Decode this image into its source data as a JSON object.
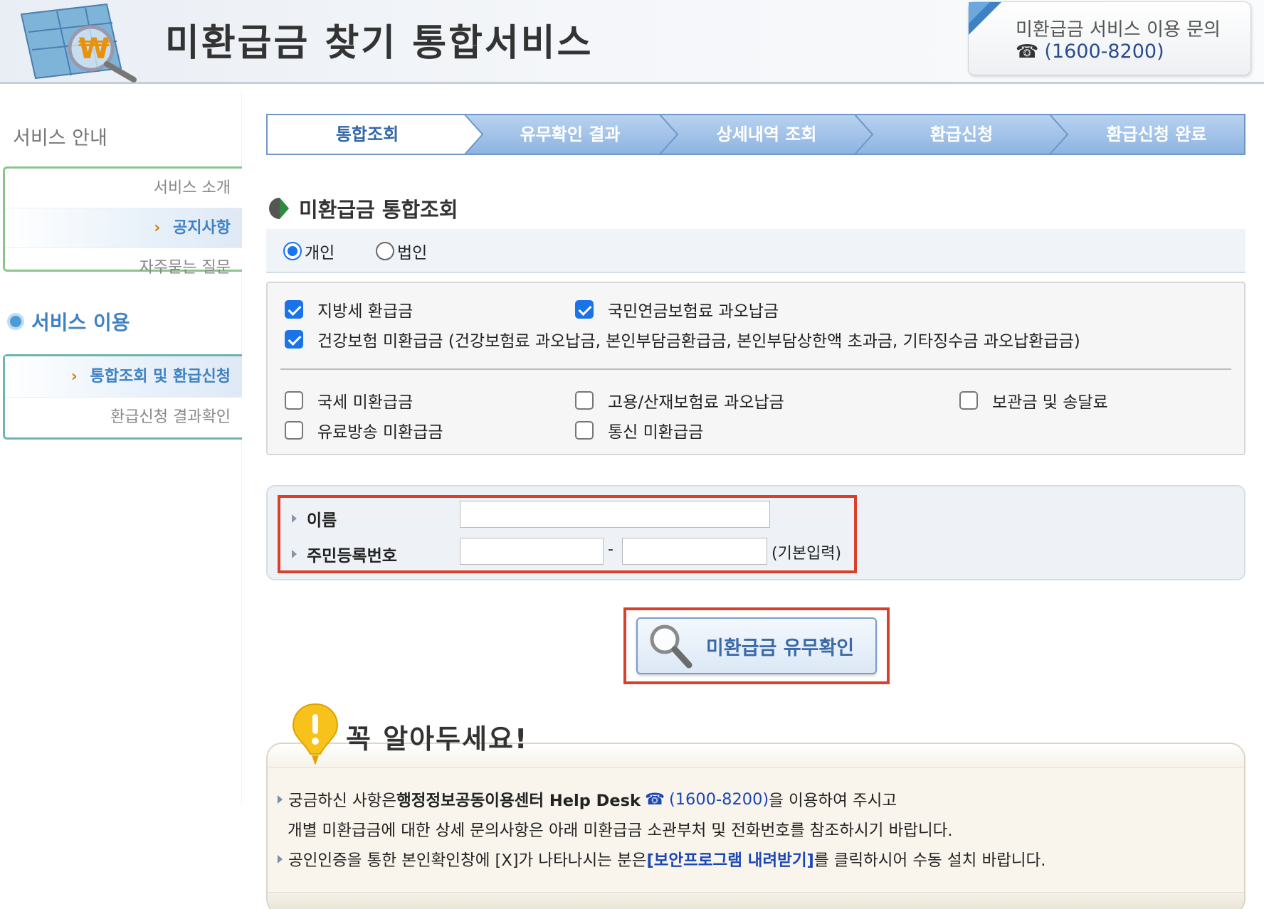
{
  "header": {
    "site_title": "미환급금 찾기 통합서비스",
    "contact_label": "미환급금 서비스 이용 문의",
    "contact_phone": "(1600-8200)"
  },
  "sidebar": {
    "guide_title": "서비스 안내",
    "guide_items": [
      {
        "label": "서비스 소개",
        "active": false
      },
      {
        "label": "공지사항",
        "active": true
      },
      {
        "label": "자주묻는 질문",
        "active": false
      }
    ],
    "use_title": "서비스 이용",
    "use_items": [
      {
        "label": "통합조회 및 환급신청",
        "active": true
      },
      {
        "label": "환급신청 결과확인",
        "active": false
      }
    ]
  },
  "steps": [
    {
      "label": "통합조회",
      "current": true
    },
    {
      "label": "유무확인 결과",
      "current": false
    },
    {
      "label": "상세내역 조회",
      "current": false
    },
    {
      "label": "환급신청",
      "current": false
    },
    {
      "label": "환급신청 완료",
      "current": false
    }
  ],
  "section_title": "미환급금 통합조회",
  "type_options": [
    {
      "label": "개인",
      "selected": true
    },
    {
      "label": "법인",
      "selected": false
    }
  ],
  "checks": {
    "local_tax": {
      "label": "지방세 환급금",
      "checked": true
    },
    "pension": {
      "label": "국민연금보험료 과오납금",
      "checked": true
    },
    "health": {
      "label": "건강보험 미환급금 (건강보험료 과오납금, 본인부담금환급금, 본인부담상한액 초과금, 기타징수금 과오납환급금)",
      "checked": true
    },
    "national_tax": {
      "label": "국세 미환급금",
      "checked": false
    },
    "employment": {
      "label": "고용/산재보험료 과오납금",
      "checked": false
    },
    "deposit": {
      "label": "보관금 및 송달료",
      "checked": false
    },
    "cable": {
      "label": "유료방송 미환급금",
      "checked": false
    },
    "telecom": {
      "label": "통신 미환급금",
      "checked": false
    }
  },
  "form": {
    "name_label": "이름",
    "name_value": "",
    "rrn_label": "주민등록번호",
    "rrn_front": "",
    "rrn_back": "",
    "rrn_dash": "-",
    "rrn_hint": "(기본입력)"
  },
  "check_button_label": "미환급금 유무확인",
  "notice": {
    "title": "꼭 알아두세요!",
    "line1_a": "궁금하신 사항은 ",
    "line1_bold": "행정정보공동이용센터 Help Desk",
    "line1_phone": "(1600-8200)",
    "line1_b": "을 이용하여 주시고",
    "line2": "개별 미환급금에 대한 상세 문의사항은 아래 미환급금 소관부처 및 전화번호를 참조하시기 바랍니다.",
    "line3_a": "공인인증을 통한 본인확인창에 [X]가 나타나시는 분은 ",
    "line3_link": "[보안프로그램 내려받기]",
    "line3_b": "를 클릭하시어 수동 설치 바랍니다."
  },
  "colors": {
    "accent_blue": "#3e82c4",
    "highlight_red": "#d9402b",
    "check_blue": "#1a73e8"
  }
}
